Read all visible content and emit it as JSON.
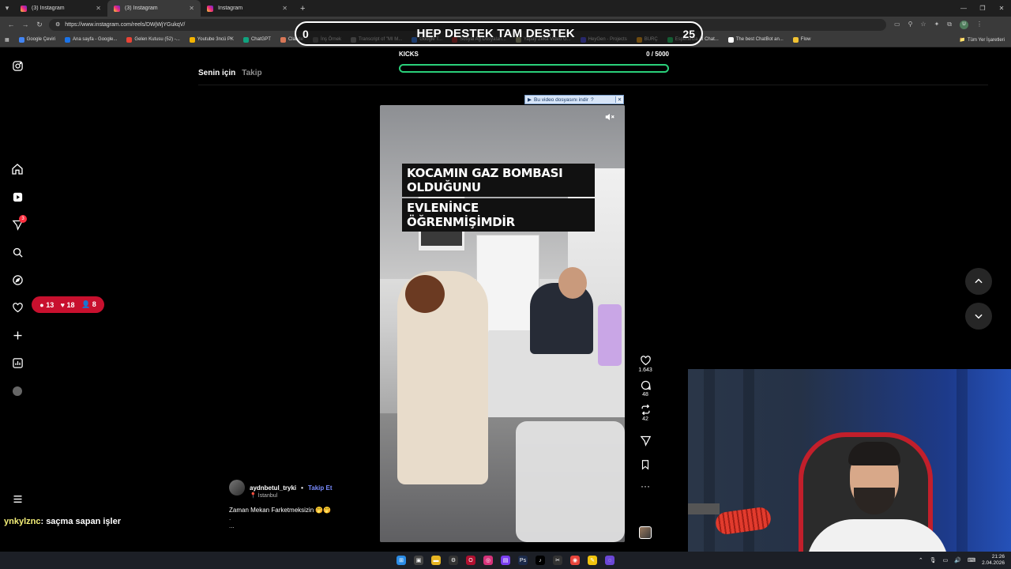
{
  "browser": {
    "tabs": [
      {
        "title": "(3) Instagram",
        "active": false
      },
      {
        "title": "(3) Instagram",
        "active": true
      },
      {
        "title": "Instagram",
        "active": false
      }
    ],
    "url": "https://www.instagram.com/reels/DWjWjYGukqV/",
    "bookmarks": [
      "Google Çeviri",
      "Ana sayfa - Google...",
      "Gelen Kutusu (52) -...",
      "Youtube 3ncü PK",
      "ChatGPT",
      "Claude",
      "İnş Örnek",
      "Transcript of \"MI M...",
      "Google T...",
      "Sosyal Ağ Dosyaları...",
      "Yapay Zeka Video G...",
      "HeyGen - Projects",
      "BURÇ",
      "Esperanza AI Chat...",
      "The best ChatBot an...",
      "Flow"
    ],
    "bookmarks_right": "Tüm Yer İşaretleri",
    "profile_initial": "U"
  },
  "overlay": {
    "goal_left": "0",
    "goal_title": "HEP DESTEK TAM DESTEK",
    "goal_right": "25",
    "kicks_label": "KICKS",
    "kicks_value": "0 / 5000",
    "kicks_progress": 0,
    "notif_comments": "13",
    "notif_likes": "18",
    "notif_follows": "8",
    "chat_user": "ynkylznc",
    "chat_msg": ": saçma sapan işler"
  },
  "instagram": {
    "tab_for_you": "Senin için",
    "tab_following": "Takip",
    "notification_badge": "3",
    "video_caption_line1": "KOCAMIN GAZ BOMBASI OLDUĞUNU",
    "video_caption_line2": "EVLENİNCE ÖĞRENMİŞİMDİR",
    "download_widget": "Bu video dosyasını indir",
    "download_help": "?",
    "likes": "1.643",
    "comments": "48",
    "reposts": "42",
    "author_name": "aydnbetul_tryki",
    "follow_label": "Takip Et",
    "author_location": "İstanbul",
    "description": "Zaman Mekan Farketmeksizin 🤭🤭",
    "description_more1": ".",
    "description_more2": "..."
  },
  "taskbar": {
    "time": "21:26",
    "date": "2.04.2026"
  }
}
